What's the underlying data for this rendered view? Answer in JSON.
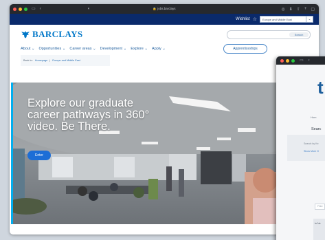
{
  "browser": {
    "url": "jobs.barclays",
    "lock_icon": "lock-icon"
  },
  "site": {
    "wishlist": "Wishlist",
    "region": "Europe and Middle East",
    "brand": "BARCLAYS",
    "search_placeholder": "",
    "search_button": "Search",
    "nav": [
      {
        "label": "About"
      },
      {
        "label": "Opportunities"
      },
      {
        "label": "Career areas"
      },
      {
        "label": "Development"
      },
      {
        "label": "Explore"
      },
      {
        "label": "Apply"
      }
    ],
    "apprenticeships": "Apprenticeships",
    "breadcrumb": {
      "back": "Back to:",
      "home": "Homepage",
      "current": "Europe and Middle East"
    },
    "hero": {
      "title": "Explore our graduate career pathways in 360° video. Be There.",
      "cta": "Enter"
    }
  },
  "second_window": {
    "logo": "t",
    "label_top": "Hom",
    "search_label": "Searc",
    "box_line1": "Search by Ke",
    "box_line2": "Show More O",
    "field_text": "Filter",
    "band_text": "In Ne"
  },
  "colors": {
    "brand_blue": "#0077c8",
    "header_navy": "#0a2a6b",
    "cta_blue": "#1d6ed6",
    "accent_cyan": "#00aeef"
  }
}
